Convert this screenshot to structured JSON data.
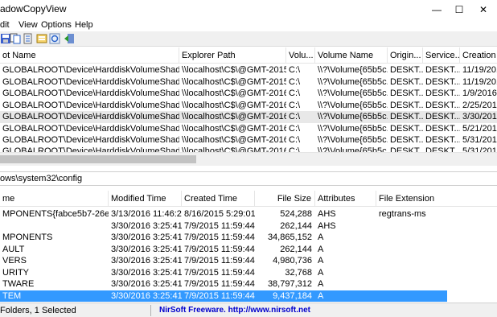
{
  "window": {
    "title": "adowCopyView",
    "minimize_glyph": "—",
    "restore_glyph": "☐",
    "close_glyph": "✕"
  },
  "menu": [
    "dit",
    "View",
    "Options",
    "Help"
  ],
  "toolbar_icons": [
    "save-icon",
    "copy-icon",
    "copy-file-icon",
    "properties-icon",
    "refresh-icon",
    "exit-icon"
  ],
  "top_table": {
    "headers": [
      "ot Name",
      "Explorer Path",
      "Volu...",
      "Volume Name",
      "Origin...",
      "Service...",
      "Creation T"
    ],
    "rows": [
      [
        "GLOBALROOT\\Device\\HarddiskVolumeShadowCopy1",
        "\\\\localhost\\C$\\@GMT-2015...",
        "C:\\",
        "\\\\?\\Volume{65b5c...",
        "DESKT...",
        "DESKT...",
        "11/19/2015"
      ],
      [
        "GLOBALROOT\\Device\\HarddiskVolumeShadowCopy2",
        "\\\\localhost\\C$\\@GMT-2015...",
        "C:\\",
        "\\\\?\\Volume{65b5c...",
        "DESKT...",
        "DESKT...",
        "11/19/2015"
      ],
      [
        "GLOBALROOT\\Device\\HarddiskVolumeShadowCopy3",
        "\\\\localhost\\C$\\@GMT-2016...",
        "C:\\",
        "\\\\?\\Volume{65b5c...",
        "DESKT...",
        "DESKT...",
        "1/9/2016 1"
      ],
      [
        "GLOBALROOT\\Device\\HarddiskVolumeShadowCopy4",
        "\\\\localhost\\C$\\@GMT-2016...",
        "C:\\",
        "\\\\?\\Volume{65b5c...",
        "DESKT...",
        "DESKT...",
        "2/25/2016"
      ],
      [
        "GLOBALROOT\\Device\\HarddiskVolumeShadowCopy5",
        "\\\\localhost\\C$\\@GMT-2016...",
        "C:\\",
        "\\\\?\\Volume{65b5c...",
        "DESKT...",
        "DESKT...",
        "3/30/2016"
      ],
      [
        "GLOBALROOT\\Device\\HarddiskVolumeShadowCopy6",
        "\\\\localhost\\C$\\@GMT-2016...",
        "C:\\",
        "\\\\?\\Volume{65b5c...",
        "DESKT...",
        "DESKT...",
        "5/21/2016"
      ],
      [
        "GLOBALROOT\\Device\\HarddiskVolumeShadowCopy7",
        "\\\\localhost\\C$\\@GMT-2016...",
        "C:\\",
        "\\\\?\\Volume{65b5c...",
        "DESKT...",
        "DESKT...",
        "5/31/2016"
      ],
      [
        "GLOBALROOT\\Device\\HarddiskVolumeShadowCopy8",
        "\\\\localhost\\C$\\@GMT-2016...",
        "C:\\",
        "\\\\?\\Volume{65b5c...",
        "DESKT...",
        "DESKT...",
        "5/31/2016"
      ]
    ]
  },
  "path": "ows\\system32\\config",
  "bottom_table": {
    "headers": [
      "me",
      "Modified Time",
      "Created Time",
      "File Size",
      "Attributes",
      "File Extension"
    ],
    "rows": [
      [
        "MPONENTS{fabce5b7-26ee-11e...",
        "3/13/2016 11:46:21...",
        "8/16/2015 5:29:01 ...",
        "524,288",
        "AHS",
        "regtrans-ms"
      ],
      [
        "",
        "3/30/2016 3:25:41 ...",
        "7/9/2015 11:59:44 ...",
        "262,144",
        "AHS",
        ""
      ],
      [
        "MPONENTS",
        "3/30/2016 3:25:41 ...",
        "7/9/2015 11:59:44 ...",
        "34,865,152",
        "A",
        ""
      ],
      [
        "AULT",
        "3/30/2016 3:25:41 ...",
        "7/9/2015 11:59:44 ...",
        "262,144",
        "A",
        ""
      ],
      [
        "VERS",
        "3/30/2016 3:25:41 ...",
        "7/9/2015 11:59:44 ...",
        "4,980,736",
        "A",
        ""
      ],
      [
        "URITY",
        "3/30/2016 3:25:41 ...",
        "7/9/2015 11:59:44 ...",
        "32,768",
        "A",
        ""
      ],
      [
        "TWARE",
        "3/30/2016 3:25:41 ...",
        "7/9/2015 11:59:44 ...",
        "38,797,312",
        "A",
        ""
      ],
      [
        "TEM",
        "3/30/2016 3:25:41 ...",
        "7/9/2015 11:59:44 ...",
        "9,437,184",
        "A",
        ""
      ]
    ]
  },
  "status": {
    "left": " Folders, 1 Selected",
    "right": "NirSoft Freeware.  http://www.nirsoft.net"
  }
}
